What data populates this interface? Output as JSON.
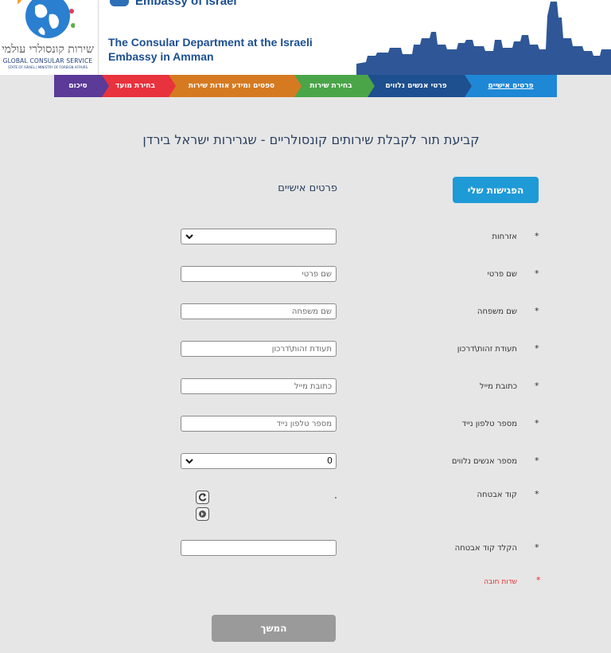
{
  "header": {
    "logo_hebrew": "שירות קונסולרי עולמי",
    "logo_english": "GLOBAL CONSULAR SERVICE",
    "logo_sub": "STATE OF ISRAEL | MINISTRY OF FOREIGN AFFAIRS",
    "embassy_top": "Embassy of Israel",
    "dept_title": "The Consular Department at the Israeli Embassy in Amman"
  },
  "nav": {
    "tabs": [
      {
        "label": "סיכום",
        "color": "#5b3a98"
      },
      {
        "label": "בחירת מועד",
        "color": "#e8323d"
      },
      {
        "label": "ספסים ומידע אודות שירות",
        "color": "#d67a22"
      },
      {
        "label": "בחירת שירות",
        "color": "#4aa548"
      },
      {
        "label": "פרטי אנשים נלווים",
        "color": "#1e4f8f"
      },
      {
        "label": "פרטים אישיים",
        "color": "#1e88d6"
      }
    ]
  },
  "main": {
    "page_title": "קביעת תור לקבלת שירותים קונסולריים - שגרירות ישראל בירדן",
    "my_appointments": "הפגישות שלי",
    "section_title": "פרטים אישיים",
    "required_marker": "*",
    "fields": {
      "citizenship": {
        "label": "אזרחות",
        "value": ""
      },
      "first_name": {
        "label": "שם פרטי",
        "placeholder": "שם פרטי"
      },
      "last_name": {
        "label": "שם משפחה",
        "placeholder": "שם משפחה"
      },
      "id_passport": {
        "label": "תעודת זהות\\דרכון",
        "placeholder": "תעודת זהות\\דרכון"
      },
      "email": {
        "label": "כתובת מייל",
        "placeholder": "כתובת מייל"
      },
      "mobile": {
        "label": "מספר טלפון נייד",
        "placeholder": "מספר טלפון נייד"
      },
      "companions": {
        "label": "מספר אנשים נלווים",
        "value": "0"
      },
      "captcha": {
        "label": "קוד אבטחה"
      },
      "captcha_input": {
        "label": "הקלד קוד אבטחה",
        "value": ""
      }
    },
    "mandatory_note": "שדות חובה",
    "continue": "המשך"
  }
}
